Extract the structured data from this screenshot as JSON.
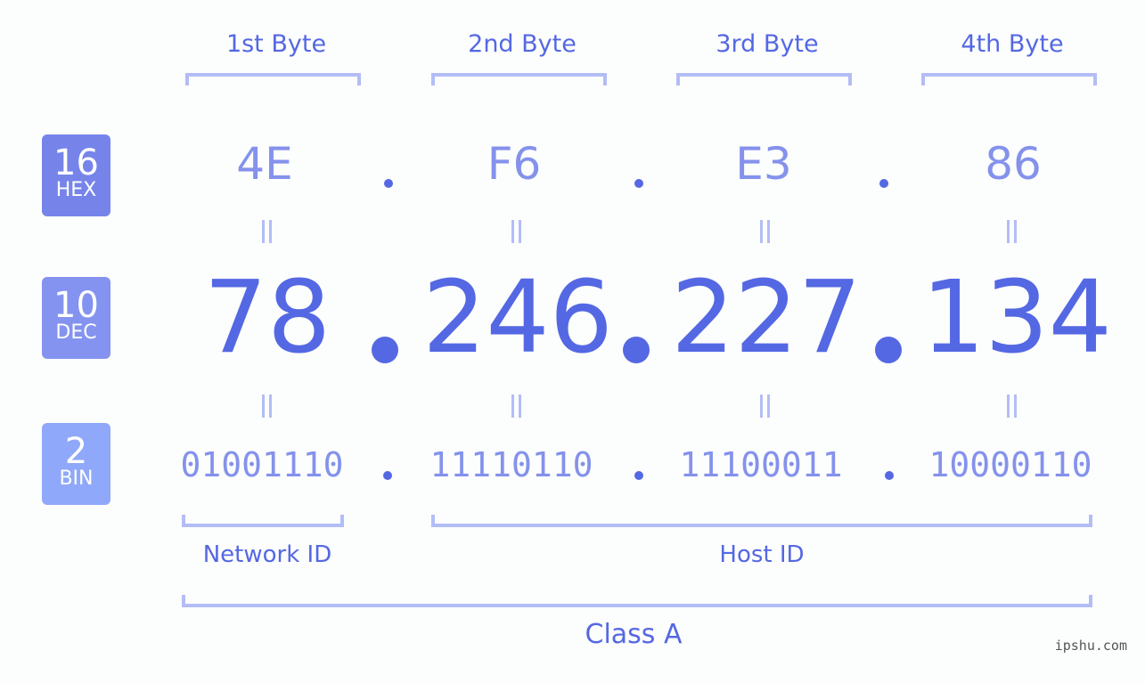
{
  "headers": [
    "1st Byte",
    "2nd Byte",
    "3rd Byte",
    "4th Byte"
  ],
  "badges": [
    {
      "num": "16",
      "label": "HEX",
      "color": "#7684ea"
    },
    {
      "num": "10",
      "label": "DEC",
      "color": "#8493ef"
    },
    {
      "num": "2",
      "label": "BIN",
      "color": "#8fa8f9"
    }
  ],
  "hex": [
    "4E",
    "F6",
    "E3",
    "86"
  ],
  "dec": [
    "78",
    "246",
    "227",
    "134"
  ],
  "bin": [
    "01001110",
    "11110110",
    "11100011",
    "10000110"
  ],
  "labels": {
    "network": "Network ID",
    "host": "Host ID",
    "class": "Class A"
  },
  "watermark": "ipshu.com",
  "colors": {
    "primary": "#5468e3",
    "light": "#8492ec",
    "bracket": "#b3bdf5"
  }
}
